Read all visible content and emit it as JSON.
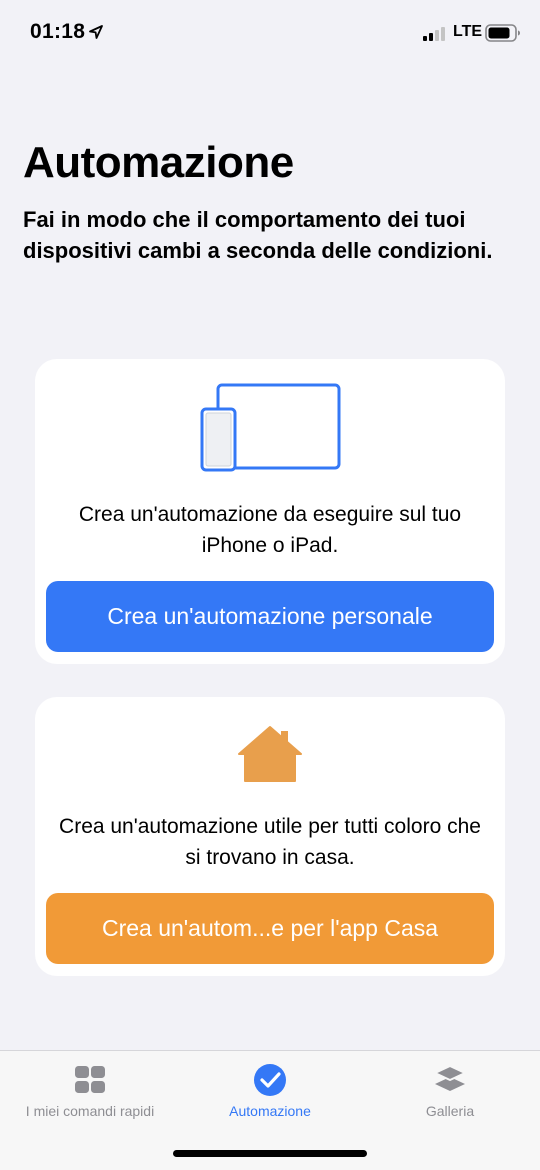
{
  "status_bar": {
    "time": "01:18",
    "network": "LTE",
    "location_icon": "location-arrow-icon",
    "signal_icon": "cellular-signal-icon",
    "battery_icon": "battery-icon"
  },
  "header": {
    "title": "Automazione",
    "subtitle": "Fai in modo che il comportamento dei tuoi dispositivi cambi a seconda delle condizioni."
  },
  "cards": [
    {
      "icon": "iphone-ipad-icon",
      "text": "Crea un'automazione da eseguire sul tuo iPhone o iPad.",
      "button_label": "Crea un'automazione personale",
      "button_color": "#3478f6"
    },
    {
      "icon": "home-icon",
      "text": "Crea un'automazione utile per tutti coloro che si trovano in casa.",
      "button_label": "Crea un'autom...e per l'app Casa",
      "button_color": "#f19a37"
    }
  ],
  "tab_bar": {
    "tabs": [
      {
        "label": "I miei comandi rapidi",
        "icon": "grid-icon",
        "selected": false
      },
      {
        "label": "Automazione",
        "icon": "checkmark-circle-icon",
        "selected": true
      },
      {
        "label": "Galleria",
        "icon": "layers-icon",
        "selected": false
      }
    ],
    "active_color": "#3478f6",
    "inactive_color": "#8e8e93"
  }
}
